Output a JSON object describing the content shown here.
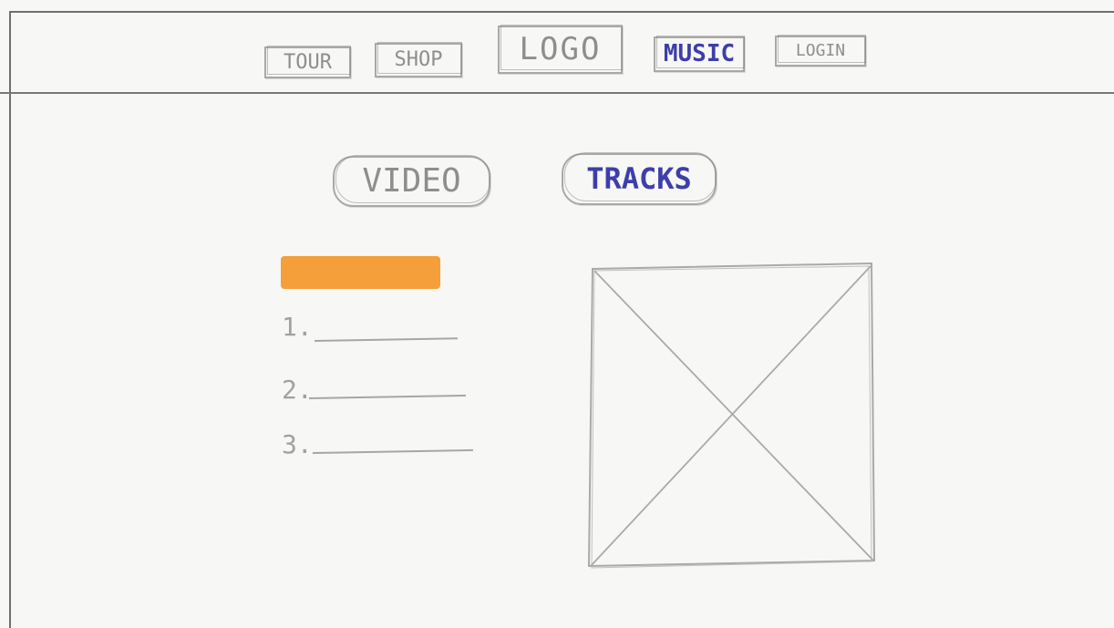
{
  "nav": {
    "items": [
      {
        "label": "TOUR",
        "active": false
      },
      {
        "label": "SHOP",
        "active": false
      },
      {
        "label": "LOGO",
        "active": false
      },
      {
        "label": "MUSIC",
        "active": true
      },
      {
        "label": "LOGIN",
        "active": false
      }
    ]
  },
  "tabs": {
    "items": [
      {
        "label": "VIDEO",
        "active": false
      },
      {
        "label": "TRACKS",
        "active": true
      }
    ]
  },
  "tracks": {
    "items": [
      {
        "number": "1."
      },
      {
        "number": "2."
      },
      {
        "number": "3."
      }
    ]
  },
  "colors": {
    "active_text": "#3e3eaa",
    "highlight_bar": "#f39a2e",
    "sketch_gray": "#a8a8a8"
  }
}
